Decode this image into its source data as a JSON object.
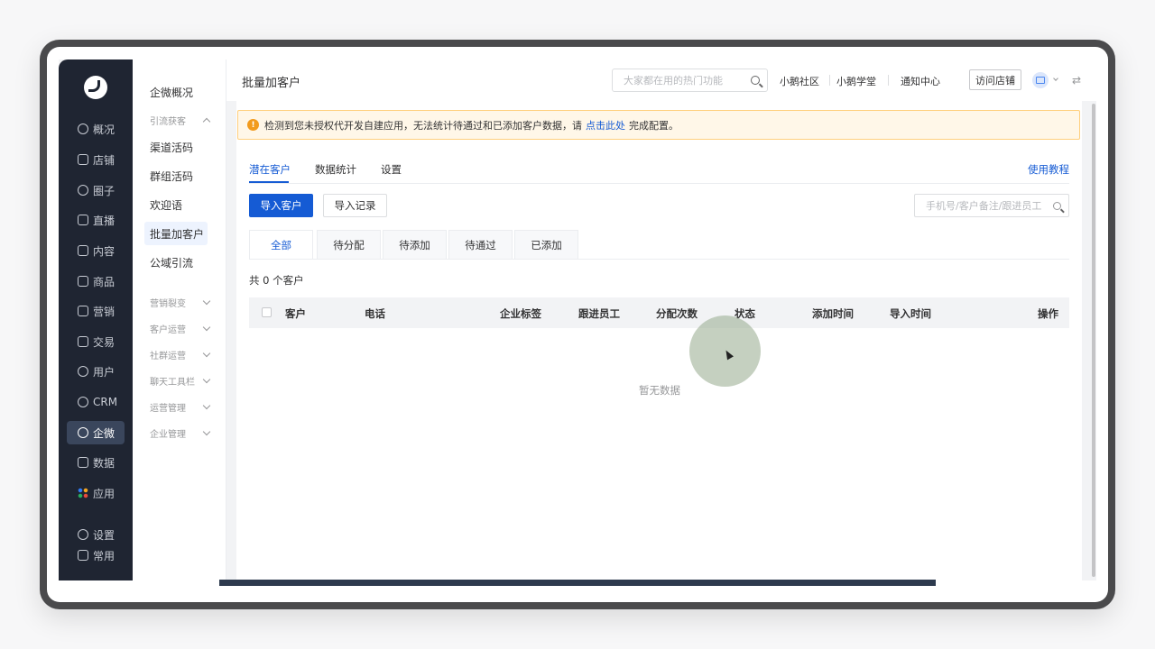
{
  "nav_primary": {
    "items": [
      {
        "label": "概况",
        "icon": "pie-chart-icon"
      },
      {
        "label": "店铺",
        "icon": "store-icon"
      },
      {
        "label": "圈子",
        "icon": "people-icon"
      },
      {
        "label": "直播",
        "icon": "live-icon"
      },
      {
        "label": "内容",
        "icon": "document-icon"
      },
      {
        "label": "商品",
        "icon": "box-icon"
      },
      {
        "label": "营销",
        "icon": "megaphone-icon"
      },
      {
        "label": "交易",
        "icon": "transaction-icon"
      },
      {
        "label": "用户",
        "icon": "user-icon"
      },
      {
        "label": "CRM",
        "icon": "crm-icon"
      },
      {
        "label": "企微",
        "icon": "wecom-icon",
        "active": true
      },
      {
        "label": "数据",
        "icon": "chart-icon"
      },
      {
        "label": "应用",
        "icon": "apps-icon"
      }
    ],
    "bottom": [
      {
        "label": "设置",
        "icon": "gear-icon"
      },
      {
        "label": "常用",
        "icon": "list-icon"
      }
    ]
  },
  "nav_secondary": {
    "overview": "企微概况",
    "group_acquire": "引流获客",
    "items": [
      "渠道活码",
      "群组活码",
      "欢迎语",
      "批量加客户",
      "公域引流"
    ],
    "active_item": "批量加客户",
    "collapsed_groups": [
      "营销裂变",
      "客户运营",
      "社群运营",
      "聊天工具栏",
      "运营管理",
      "企业管理"
    ]
  },
  "header": {
    "title": "批量加客户",
    "search_placeholder": "大家都在用的热门功能",
    "links": [
      "小鹅社区",
      "小鹅学堂",
      "通知中心"
    ],
    "visit_store": "访问店铺"
  },
  "alert": {
    "text_before": "检测到您未授权代开发自建应用，无法统计待通过和已添加客户数据，请",
    "link": "点击此处",
    "text_after": "完成配置。",
    "color": "#f29b1d"
  },
  "tabs": {
    "items": [
      "潜在客户",
      "数据统计",
      "设置"
    ],
    "active": "潜在客户",
    "tutorial": "使用教程"
  },
  "toolbar": {
    "import_customers": "导入客户",
    "import_records": "导入记录",
    "search_placeholder": "手机号/客户备注/跟进员工"
  },
  "status_tabs": {
    "items": [
      "全部",
      "待分配",
      "待添加",
      "待通过",
      "已添加"
    ],
    "active": "全部"
  },
  "summary": {
    "count_text": "共 0 个客户"
  },
  "table": {
    "columns": [
      "客户",
      "电话",
      "企业标签",
      "跟进员工",
      "分配次数",
      "状态",
      "添加时间",
      "导入时间",
      "操作"
    ],
    "rows": [],
    "empty_text": "暂无数据"
  },
  "colors": {
    "primary": "#155bd4",
    "sidebar": "#1f2532",
    "alert_bg": "#fff7e8"
  }
}
